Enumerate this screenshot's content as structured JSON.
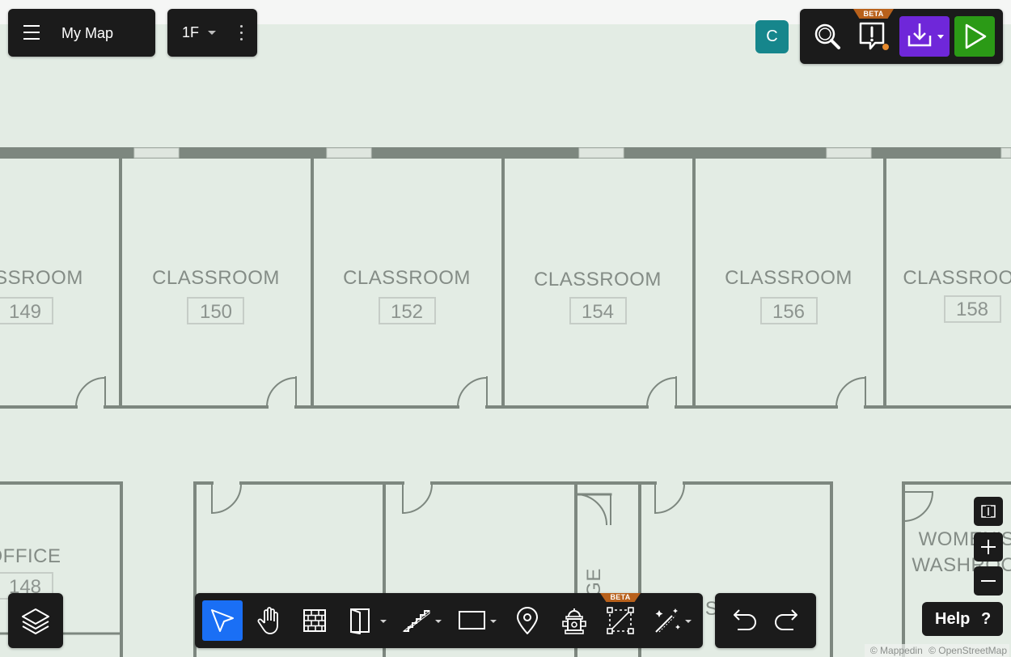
{
  "header": {
    "map_title": "My Map"
  },
  "floor": {
    "current": "1F"
  },
  "user": {
    "avatar_initial": "C"
  },
  "toolbar_top": {
    "buttons": [
      {
        "name": "search",
        "icon": "magnifier-icon"
      },
      {
        "name": "validation",
        "icon": "exclamation-bubble-icon",
        "badge": "BETA",
        "indicator_color": "#e68a2e"
      },
      {
        "name": "export",
        "icon": "download-tray-icon",
        "color": "#6f27d9"
      },
      {
        "name": "preview",
        "icon": "play-icon",
        "color": "#2b9a16"
      }
    ]
  },
  "map": {
    "rooms": [
      {
        "label": "SSROOM",
        "number": "149"
      },
      {
        "label": "CLASSROOM",
        "number": "150"
      },
      {
        "label": "CLASSROOM",
        "number": "152"
      },
      {
        "label": "CLASSROOM",
        "number": "154"
      },
      {
        "label": "CLASSROOM",
        "number": "156"
      },
      {
        "label": "CLASSROO",
        "number": "158"
      },
      {
        "label": "OFFICE",
        "number": "148"
      },
      {
        "label": "WOMEN'S",
        "number": ""
      },
      {
        "label": "WASHROO",
        "number": ""
      },
      {
        "label": "GE",
        "number": ""
      },
      {
        "label": "S",
        "number": ""
      }
    ],
    "colors": {
      "background": "#e3ece4",
      "walls": "#7d877f",
      "window": "#dfe6df"
    }
  },
  "tools": [
    {
      "name": "select",
      "icon": "cursor-arrow-icon",
      "active": true
    },
    {
      "name": "pan",
      "icon": "hand-icon"
    },
    {
      "name": "wall",
      "icon": "brick-wall-icon"
    },
    {
      "name": "door",
      "icon": "door-icon",
      "dropdown": true
    },
    {
      "name": "stairs",
      "icon": "stairs-icon",
      "dropdown": true
    },
    {
      "name": "rectangle",
      "icon": "rectangle-icon",
      "dropdown": true
    },
    {
      "name": "location",
      "icon": "map-pin-icon"
    },
    {
      "name": "fire-hydrant",
      "icon": "fire-hydrant-icon"
    },
    {
      "name": "polygon-select",
      "icon": "polygon-select-icon",
      "badge": "BETA"
    },
    {
      "name": "magic",
      "icon": "magic-wand-icon",
      "dropdown": true
    }
  ],
  "history": [
    {
      "name": "undo",
      "icon": "undo-icon"
    },
    {
      "name": "redo",
      "icon": "redo-icon"
    }
  ],
  "zoom": {
    "controls": [
      {
        "name": "fit",
        "icon": "fit-bounds-icon"
      },
      {
        "name": "in",
        "icon": "plus-icon"
      },
      {
        "name": "out",
        "icon": "minus-icon"
      }
    ]
  },
  "help": {
    "label": "Help",
    "icon_char": "?"
  },
  "attribution": {
    "mappedin": "© Mappedin",
    "osm": "© OpenStreetMap"
  }
}
